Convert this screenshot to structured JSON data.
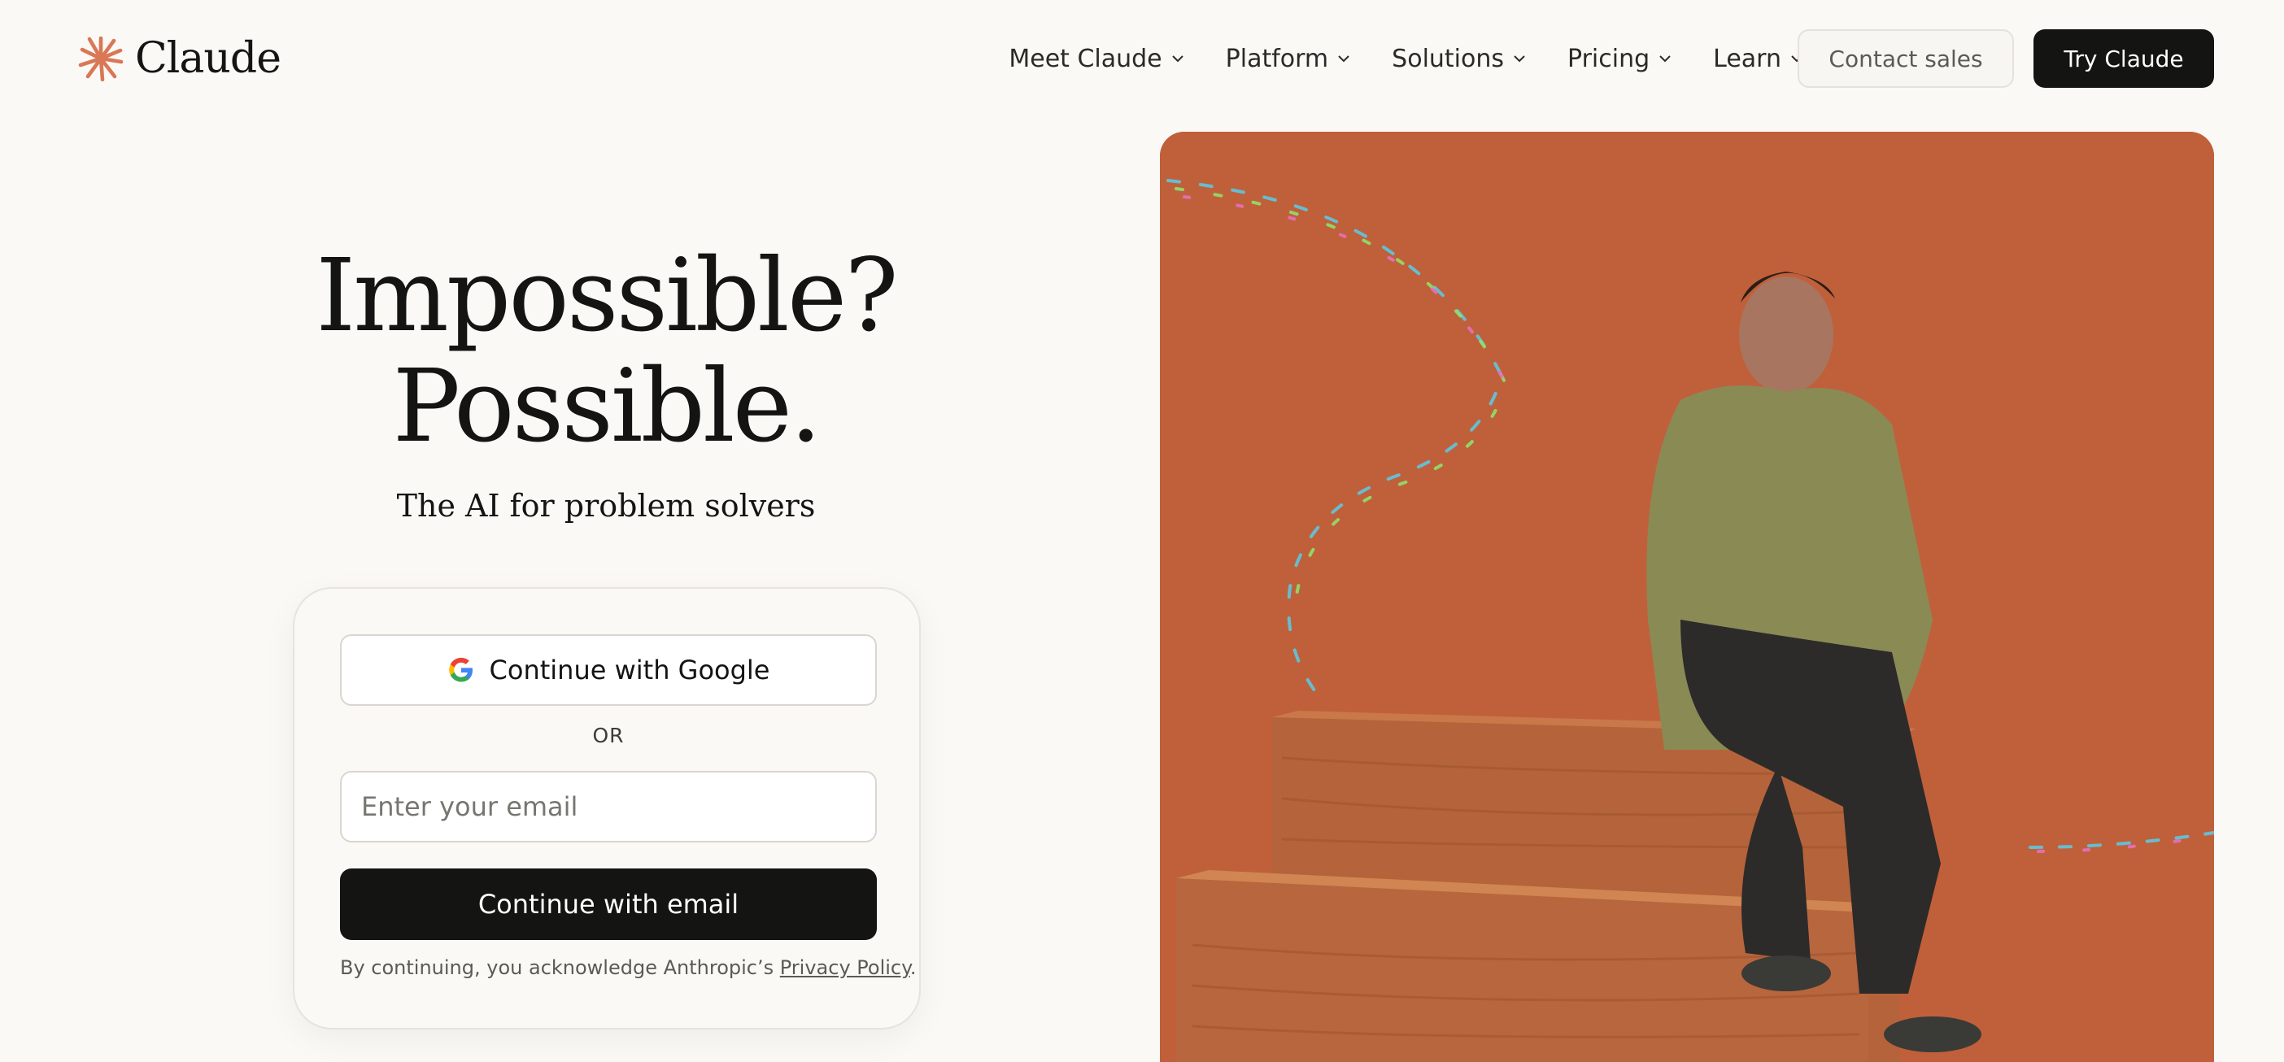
{
  "header": {
    "logo": {
      "text": "Claude",
      "icon": "claude-spark-icon",
      "color": "#d97757"
    },
    "nav": [
      {
        "label": "Meet Claude",
        "icon": "chevron-down-icon"
      },
      {
        "label": "Platform",
        "icon": "chevron-down-icon"
      },
      {
        "label": "Solutions",
        "icon": "chevron-down-icon"
      },
      {
        "label": "Pricing",
        "icon": "chevron-down-icon"
      },
      {
        "label": "Learn",
        "icon": "chevron-down-icon"
      }
    ],
    "contact_sales": "Contact sales",
    "try_claude": "Try Claude"
  },
  "hero": {
    "headline_line1": "Impossible?",
    "headline_line2": "Possible.",
    "subtitle": "The AI for problem solvers"
  },
  "signin": {
    "google_button": "Continue with Google",
    "google_icon": "google-g-icon",
    "or": "OR",
    "email_placeholder": "Enter your email",
    "email_value": "",
    "email_button": "Continue with email",
    "legal_prefix": "By continuing, you acknowledge Anthropic’s ",
    "privacy_link": "Privacy Policy",
    "legal_suffix": "."
  },
  "image": {
    "name": "hero-photo",
    "background_color": "#c0603a"
  },
  "colors": {
    "page_bg": "#faf9f5",
    "primary_dark": "#141413",
    "brand": "#d97757"
  }
}
